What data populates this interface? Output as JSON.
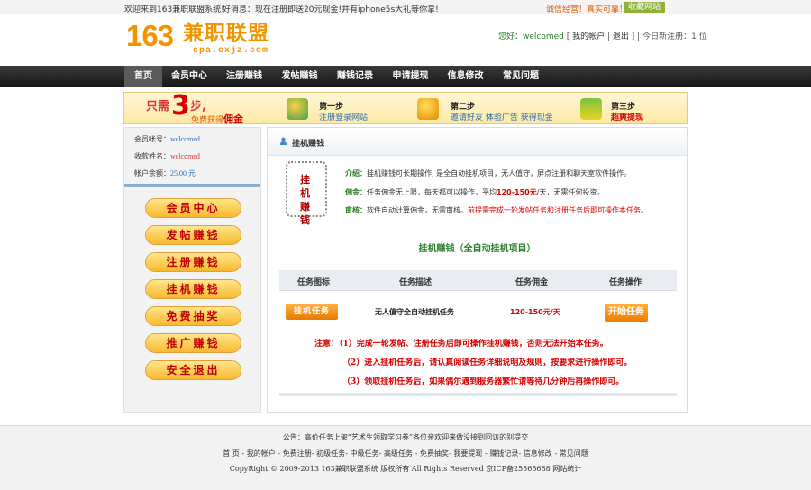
{
  "topbar": {
    "welcome": "欢迎来到163兼职联盟系统!",
    "news": "好消息：现在注册即送20元现金!并有iphone5s大礼等你拿!",
    "slogan": "诚信经营！真实可靠！",
    "favorite": "收藏网站"
  },
  "logo": {
    "num": "163",
    "cn": "兼职联盟",
    "domain": "cpa.cxjz.com"
  },
  "userinfo": {
    "greet": "您好：",
    "username": "welcomed",
    "account": "我的帐户",
    "logout": "退出",
    "today_reg_label": "今日新注册：",
    "today_reg_count": "1",
    "unit": "位"
  },
  "nav": {
    "items": [
      {
        "label": "首页"
      },
      {
        "label": "会员中心"
      },
      {
        "label": "注册赚钱"
      },
      {
        "label": "发帖赚钱"
      },
      {
        "label": "赚钱记录"
      },
      {
        "label": "申请提现"
      },
      {
        "label": "信息修改"
      },
      {
        "label": "常见问题"
      }
    ]
  },
  "steps": {
    "need": "只需",
    "three": "3",
    "bu": "步,",
    "free_prefix": "免费获得",
    "free_highlight": "佣金",
    "items": [
      {
        "title": "第一步",
        "desc": "注册登录网站"
      },
      {
        "title": "第二步",
        "desc": "邀请好友  体验广告  获得现金"
      },
      {
        "title": "第三步",
        "desc": "超爽提现"
      }
    ]
  },
  "sidebar": {
    "account_label": "会员帐号：",
    "account_value": "welcomed",
    "payee_label": "收款姓名：",
    "payee_value": "welcomed",
    "balance_label": "帐户余额：",
    "balance_value": "25.00 元",
    "menu": [
      {
        "label": "会员中心"
      },
      {
        "label": "发帖赚钱"
      },
      {
        "label": "注册赚钱"
      },
      {
        "label": "挂机赚钱"
      },
      {
        "label": "免费抽奖"
      },
      {
        "label": "推广赚钱"
      },
      {
        "label": "安全退出"
      }
    ]
  },
  "main": {
    "title": "挂机赚钱",
    "seal_text": "挂 机 赚 钱",
    "intro_label": "介绍：",
    "intro_text": "挂机赚钱可长期操作, 是全自动挂机项目，无人值守，屏点注册和聊天室软件操作。",
    "pay_label": "佣金：",
    "pay_text_a": "任务佣金无上限，每天都可以操作，平均",
    "pay_text_b": "120-150元",
    "pay_text_c": "/天，无需任何投资。",
    "review_label": "审核：",
    "review_text": "软件自动计算佣金，无需审核。",
    "review_note": "前提需完成一轮发帖任务和注册任务后即可操作本任务。",
    "project_title": "挂机赚钱（全自动挂机项目）",
    "table": {
      "headers": [
        "任务图标",
        "任务描述",
        "任务佣金",
        "任务操作"
      ],
      "row": {
        "icon_label": "挂机任务",
        "desc": "无人值守全自动挂机任务",
        "pay": "120-150元/天",
        "action": "开始任务"
      }
    },
    "notes": [
      "注意：（1）完成一轮发帖、注册任务后即可操作挂机赚钱，否则无法开始本任务。",
      "（2）进入挂机任务后，请认真阅读任务详细说明及规则，按要求进行操作即可。",
      "（3）领取挂机任务后，如果偶尔遇到服务器繁忙请等待几分钟后再操作即可。"
    ]
  },
  "footer": {
    "notice": "公告：高价任务上架“艺术生领取学习券”各位亲欢迎来做没接到回访的别提交",
    "links": "首 页 - 我的帐户 - 免费注册- 初级任务- 中级任务- 高级任务 - 免费抽奖- 我要提现 - 赚钱记录- 信息修改 - 常见问题",
    "copyright": "CopyRight © 2009-2013 163兼职联盟系统 版权所有 All Rights Reserved 京ICP备25565688 网站统计"
  },
  "colors": {
    "accent_orange": "#f29300",
    "nav_bg": "#1f1f1f",
    "highlight_red": "#d80000",
    "label_green": "#2a7d2a"
  }
}
